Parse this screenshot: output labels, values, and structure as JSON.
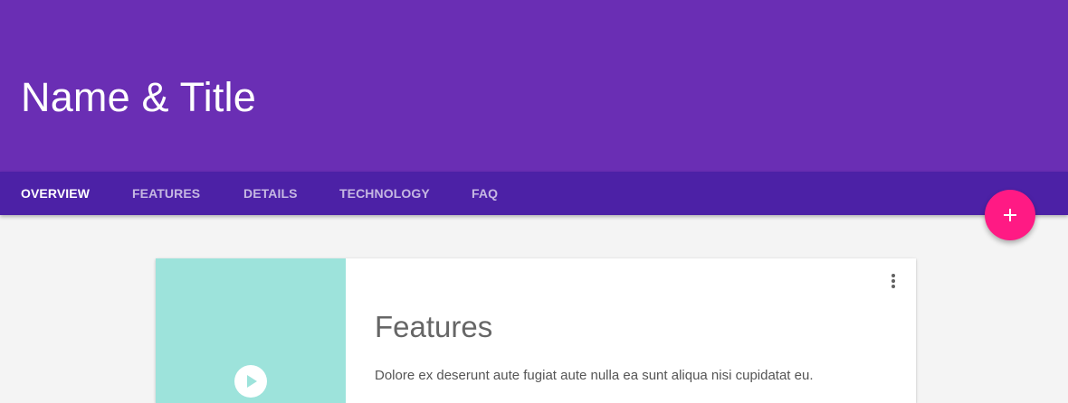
{
  "header": {
    "title": "Name & Title",
    "background_color": "#6a2eb4"
  },
  "tabs": [
    {
      "label": "OVERVIEW",
      "active": true
    },
    {
      "label": "FEATURES",
      "active": false
    },
    {
      "label": "DETAILS",
      "active": false
    },
    {
      "label": "TECHNOLOGY",
      "active": false
    },
    {
      "label": "FAQ",
      "active": false
    }
  ],
  "tabbar": {
    "background_color": "#4c21a6"
  },
  "fab": {
    "icon": "plus-icon",
    "color": "#ff1a84"
  },
  "card": {
    "title": "Features",
    "body": "Dolore ex deserunt aute fugiat aute nulla ea sunt aliqua nisi cupidatat eu.",
    "media_color": "#9de3db",
    "media_icon": "play-icon",
    "menu_icon": "more-vert-icon"
  }
}
